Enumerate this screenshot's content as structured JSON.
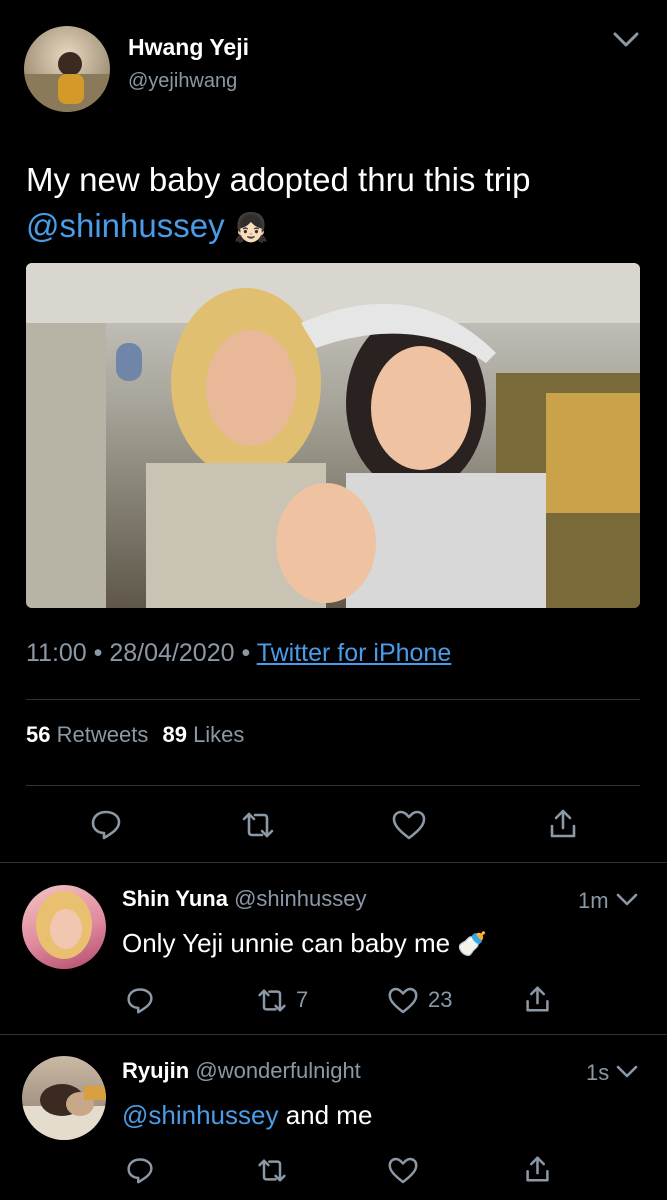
{
  "main_tweet": {
    "display_name": "Hwang Yeji",
    "handle": "@yejihwang",
    "text": "My new baby adopted thru this trip",
    "mention": "@shinhussey",
    "emoji": "👧🏻",
    "time": "11:00",
    "date": "28/04/2020",
    "source": "Twitter for iPhone",
    "retweets_count": "56",
    "retweets_label": "Retweets",
    "likes_count": "89",
    "likes_label": "Likes"
  },
  "replies": [
    {
      "display_name": "Shin Yuna",
      "handle": "@shinhussey",
      "age": "1m",
      "text": "Only Yeji unnie can baby me",
      "emoji": "🍼",
      "retweets": "7",
      "likes": "23"
    },
    {
      "display_name": "Ryujin",
      "handle": "@wonderfulnight",
      "age": "1s",
      "mention": "@shinhussey",
      "text": " and me"
    }
  ],
  "icons": [
    "chevron-down-icon",
    "reply-icon",
    "retweet-icon",
    "like-icon",
    "share-icon"
  ],
  "colors": {
    "background": "#000000",
    "text": "#ffffff",
    "muted": "#8b98a5",
    "link": "#4a9ce8",
    "divider": "#2f3336"
  }
}
